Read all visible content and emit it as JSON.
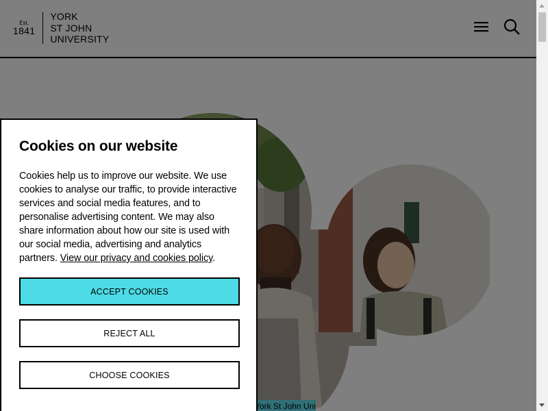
{
  "header": {
    "logo": {
      "est": "Est.",
      "year": "1841",
      "name_line1": "YORK",
      "name_line2": "ST JOHN",
      "name_line3": "UNIVERSITY"
    },
    "menu_icon": "hamburger-menu-icon",
    "search_icon": "search-icon"
  },
  "hero": {
    "caption": "York St John University"
  },
  "cookie_banner": {
    "title": "Cookies on our website",
    "body": "Cookies help us to improve our website. We use cookies to analyse our traffic, to provide interactive services and social media features, and to personalise advertising content. We may also share information about how our site is used with our social media, advertising and analytics partners.",
    "link_text": "View our privacy and cookies policy",
    "link_suffix": ".",
    "accept_label": "ACCEPT COOKIES",
    "reject_label": "REJECT ALL",
    "choose_label": "CHOOSE COOKIES"
  },
  "colors": {
    "accent": "#4ddbe5",
    "overlay": "rgba(0,0,0,0.5)",
    "border": "#000000"
  }
}
